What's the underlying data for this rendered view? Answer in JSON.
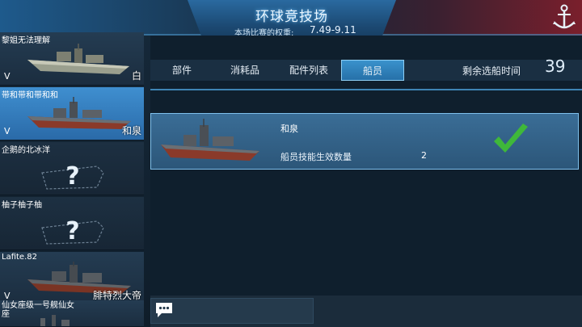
{
  "header": {
    "title": "环球竞技场",
    "weight_label": "本场比赛的权重:",
    "weight_value": "7.49-9.11",
    "icon": "anchor-icon"
  },
  "ship_list": [
    {
      "name": "黎姐无法理解",
      "level": "V",
      "tag": "白",
      "state": "filled"
    },
    {
      "name": "带和带和带和和",
      "level": "V",
      "tag": "和泉",
      "state": "selected"
    },
    {
      "name": "企鹅的北冰洋",
      "level": "",
      "tag": "",
      "state": "empty"
    },
    {
      "name": "柚子柚子柚",
      "level": "",
      "tag": "",
      "state": "empty"
    },
    {
      "name": "Lafite.82",
      "level": "V",
      "tag": "腓特烈大帝",
      "state": "filled"
    },
    {
      "name": "仙女座级一号舰仙女座",
      "level": "",
      "tag": "",
      "state": "partial"
    }
  ],
  "tabs": [
    {
      "label": "部件",
      "active": false
    },
    {
      "label": "消耗品",
      "active": false
    },
    {
      "label": "配件列表",
      "active": false
    },
    {
      "label": "船员",
      "active": true
    }
  ],
  "remaining": {
    "label": "剩余选船时间",
    "value": "39"
  },
  "crew": {
    "ship_name": "和泉",
    "skill_label": "船员技能生效数量",
    "skill_value": "2",
    "status_icon": "checkmark-icon"
  },
  "chat": {
    "icon": "chat-bubble-icon"
  },
  "colors": {
    "accent_blue": "#3a92cc",
    "check_green": "#3fb83a"
  }
}
